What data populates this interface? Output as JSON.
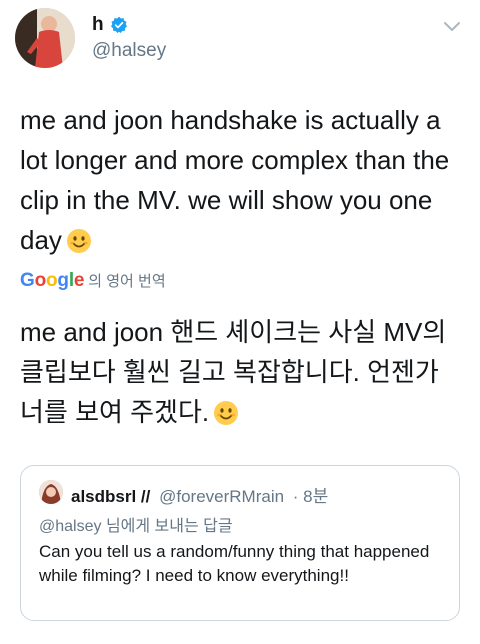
{
  "author": {
    "display_name": "h",
    "handle": "@halsey",
    "verified": true
  },
  "tweet": {
    "text": "me and joon handshake is actually a lot longer and more complex than the clip in the MV. we will show you one day",
    "emoji": "smiling-face-emoji"
  },
  "translation": {
    "google_letters": [
      "G",
      "o",
      "o",
      "g",
      "l",
      "e"
    ],
    "google_colors": [
      "#4285F4",
      "#EA4335",
      "#FBBC05",
      "#4285F4",
      "#34A853",
      "#EA4335"
    ],
    "label": "의 영어 번역",
    "text": "me and joon 핸드 셰이크는 사실 MV의 클립보다 훨씬 길고 복잡합니다. 언젠가 너를 보여 주겠다."
  },
  "quoted_tweet": {
    "display_name": "alsdbsrl //",
    "handle": "@foreverRMrain",
    "time": "· 8분",
    "reply_handle": "@halsey",
    "reply_label": "님에게 보내는 답글",
    "text": "Can you tell us a random/funny thing that happened while filming? I need to know everything!!"
  },
  "colors": {
    "verified_blue": "#1DA1F2",
    "secondary_text": "#657786",
    "border": "#CCD6DD"
  }
}
